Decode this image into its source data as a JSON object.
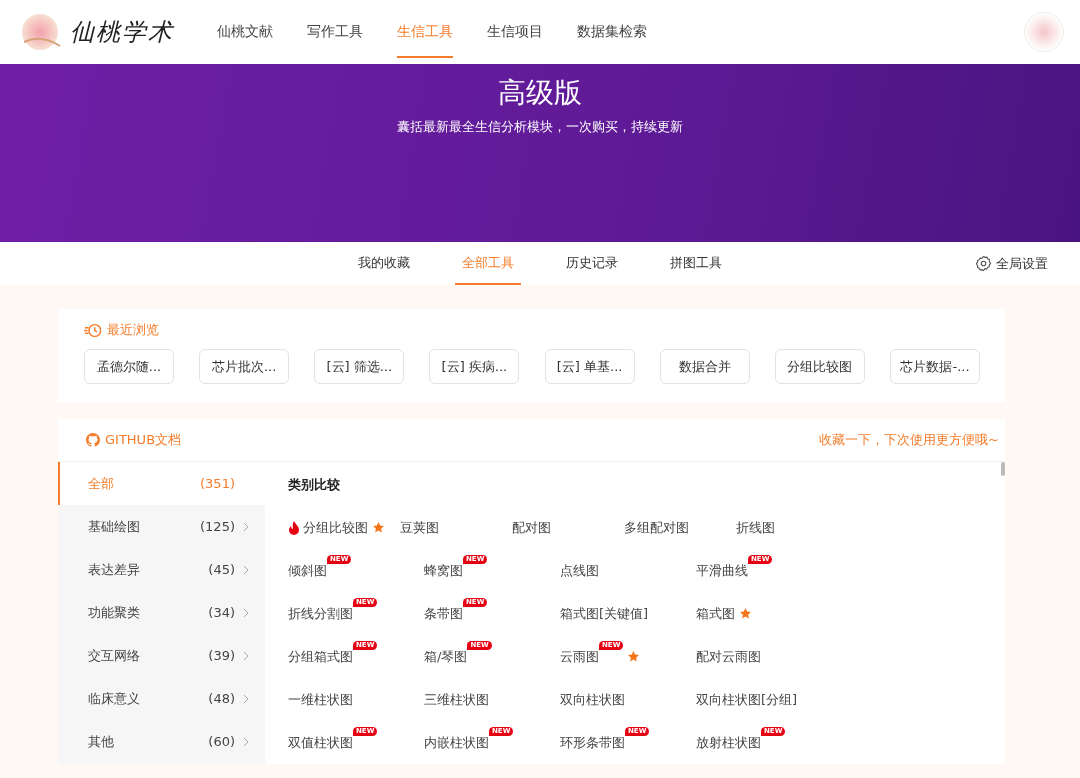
{
  "header": {
    "logo_text": "仙桃学术",
    "nav": [
      {
        "label": "仙桃文献",
        "selected": false
      },
      {
        "label": "写作工具",
        "selected": false
      },
      {
        "label": "生信工具",
        "selected": true
      },
      {
        "label": "生信项目",
        "selected": false
      },
      {
        "label": "数据集检索",
        "selected": false
      }
    ]
  },
  "banner": {
    "title": "高级版",
    "subtitle": "囊括最新最全生信分析模块，一次购买，持续更新"
  },
  "subnav": {
    "tabs": [
      {
        "label": "我的收藏",
        "selected": false
      },
      {
        "label": "全部工具",
        "selected": true
      },
      {
        "label": "历史记录",
        "selected": false
      },
      {
        "label": "拼图工具",
        "selected": false
      }
    ],
    "settings": "全局设置"
  },
  "recent": {
    "title": "最近浏览",
    "items": [
      "孟德尔随...",
      "芯片批次...",
      "[云] 筛选...",
      "[云] 疾病...",
      "[云] 单基...",
      "数据合并",
      "分组比较图",
      "芯片数据-..."
    ]
  },
  "tools": {
    "github": "GITHUB文档",
    "hint": "收藏一下，下次使用更方便哦~",
    "categories": [
      {
        "label": "全部",
        "count": "(351)",
        "selected": true
      },
      {
        "label": "基础绘图",
        "count": "(125)",
        "selected": false
      },
      {
        "label": "表达差异",
        "count": "(45)",
        "selected": false
      },
      {
        "label": "功能聚类",
        "count": "(34)",
        "selected": false
      },
      {
        "label": "交互网络",
        "count": "(39)",
        "selected": false
      },
      {
        "label": "临床意义",
        "count": "(48)",
        "selected": false
      },
      {
        "label": "其他",
        "count": "(60)",
        "selected": false
      }
    ],
    "section_title": "类别比较",
    "rows": [
      [
        {
          "label": "分组比较图",
          "hot": true,
          "star": true
        },
        {
          "label": "豆荚图",
          "hot": false,
          "star": false
        },
        {
          "label": "配对图",
          "hot": false,
          "star": false
        },
        {
          "label": "多组配对图",
          "hot": false,
          "star": false
        },
        {
          "label": "折线图",
          "hot": false,
          "star": false
        }
      ],
      [
        {
          "label": "倾斜图",
          "hot": false,
          "badge": "NEW",
          "star": false
        },
        {
          "label": "蜂窝图",
          "hot": false,
          "badge": "NEW",
          "star": false
        },
        {
          "label": "点线图",
          "hot": false,
          "star": false
        },
        {
          "label": "平滑曲线",
          "hot": false,
          "badge": "NEW",
          "star": false
        }
      ],
      [
        {
          "label": "折线分割图",
          "hot": false,
          "badge": "NEW",
          "star": false
        },
        {
          "label": "条带图",
          "hot": false,
          "badge": "NEW",
          "star": false
        },
        {
          "label": "箱式图[关键值]",
          "hot": false,
          "star": false
        },
        {
          "label": "箱式图",
          "hot": false,
          "star": true
        }
      ],
      [
        {
          "label": "分组箱式图",
          "hot": false,
          "badge": "NEW",
          "star": false
        },
        {
          "label": "箱/琴图",
          "hot": false,
          "badge": "NEW",
          "star": false
        },
        {
          "label": "云雨图",
          "hot": false,
          "badge": "NEW",
          "star": true
        },
        {
          "label": "配对云雨图",
          "hot": false,
          "star": false
        }
      ],
      [
        {
          "label": "一维柱状图",
          "hot": false,
          "star": false
        },
        {
          "label": "三维柱状图",
          "hot": false,
          "star": false
        },
        {
          "label": "双向柱状图",
          "hot": false,
          "star": false
        },
        {
          "label": "双向柱状图[分组]",
          "hot": false,
          "star": false
        }
      ],
      [
        {
          "label": "双值柱状图",
          "hot": false,
          "badge": "NEW",
          "star": false
        },
        {
          "label": "内嵌柱状图",
          "hot": false,
          "badge": "NEW",
          "star": false
        },
        {
          "label": "环形条带图",
          "hot": false,
          "badge": "NEW",
          "star": false
        },
        {
          "label": "放射柱状图",
          "hot": false,
          "badge": "NEW",
          "star": false
        }
      ]
    ]
  }
}
